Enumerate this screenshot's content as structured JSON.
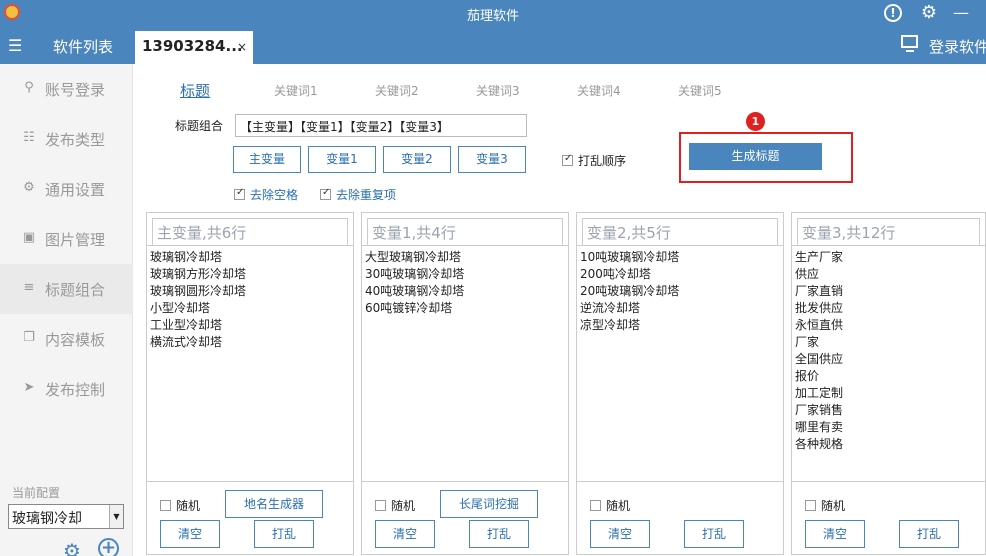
{
  "titlebar": {
    "title": "茄理软件"
  },
  "navbar": {
    "menu_label": "软件列表",
    "tab_title": "13903284...",
    "tab_close": "×",
    "login_label": "登录软件"
  },
  "sidebar": {
    "items": [
      {
        "label": "账号登录",
        "icon": "user-icon"
      },
      {
        "label": "发布类型",
        "icon": "list-icon"
      },
      {
        "label": "通用设置",
        "icon": "gear-icon"
      },
      {
        "label": "图片管理",
        "icon": "image-icon"
      },
      {
        "label": "标题组合",
        "icon": "layers-icon"
      },
      {
        "label": "内容模板",
        "icon": "copy-icon"
      },
      {
        "label": "发布控制",
        "icon": "send-icon"
      }
    ],
    "current_config_label": "当前配置",
    "current_config_value": "玻璃钢冷却"
  },
  "kw_tabs": [
    "标题",
    "关键词1",
    "关键词2",
    "关键词3",
    "关键词4",
    "关键词5"
  ],
  "title_combo": {
    "label": "标题组合",
    "value": "【主变量】【变量1】【变量2】【变量3】"
  },
  "var_buttons": [
    "主变量",
    "变量1",
    "变量2",
    "变量3"
  ],
  "shuffle_order_label": "打乱顺序",
  "generate_label": "生成标题",
  "badge_number": "1",
  "remove_space_label": "去除空格",
  "remove_dup_label": "去除重复项",
  "panels": [
    {
      "header": "主变量,共6行",
      "rows": [
        "玻璃钢冷却塔",
        "玻璃钢方形冷却塔",
        "玻璃钢圆形冷却塔",
        "小型冷却塔",
        "工业型冷却塔",
        "横流式冷却塔"
      ],
      "random_label": "随机",
      "extra_button": "地名生成器",
      "clear_label": "清空",
      "shuffle_label": "打乱"
    },
    {
      "header": "变量1,共4行",
      "rows": [
        "大型玻璃钢冷却塔",
        "30吨玻璃钢冷却塔",
        "40吨玻璃钢冷却塔",
        "60吨镀锌冷却塔"
      ],
      "random_label": "随机",
      "extra_button": "长尾词挖掘",
      "clear_label": "清空",
      "shuffle_label": "打乱"
    },
    {
      "header": "变量2,共5行",
      "rows": [
        "10吨玻璃钢冷却塔",
        "200吨冷却塔",
        "20吨玻璃钢冷却塔",
        "逆流冷却塔",
        "凉型冷却塔"
      ],
      "random_label": "随机",
      "extra_button": "",
      "clear_label": "清空",
      "shuffle_label": "打乱"
    },
    {
      "header": "变量3,共12行",
      "rows": [
        "生产厂家",
        "供应",
        "厂家直销",
        "批发供应",
        "永恒直供",
        "厂家",
        "全国供应",
        "报价",
        "加工定制",
        "厂家销售",
        "哪里有卖",
        "各种规格"
      ],
      "random_label": "随机",
      "extra_button": "",
      "clear_label": "清空",
      "shuffle_label": "打乱"
    }
  ],
  "colors": {
    "accent": "#4a86bd",
    "highlight": "#e02020"
  }
}
